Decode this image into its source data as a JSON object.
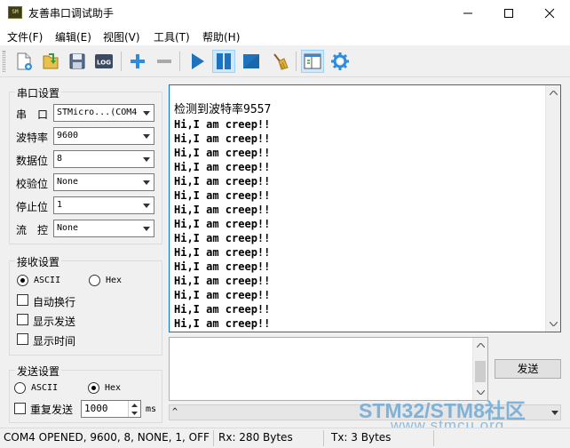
{
  "window": {
    "title": "友善串口调试助手",
    "icon_text": "SM"
  },
  "menu": [
    {
      "label": "文件(F)"
    },
    {
      "label": "编辑(E)"
    },
    {
      "label": "视图(V)"
    },
    {
      "label": "工具(T)"
    },
    {
      "label": "帮助(H)"
    }
  ],
  "toolbar": {
    "log_label": "LOG",
    "icons": [
      "new-file-icon",
      "open-file-icon",
      "save-icon",
      "log-icon",
      "add-icon",
      "remove-icon",
      "play-icon",
      "pause-icon",
      "stop-icon",
      "clear-broom-icon",
      "layout-icon",
      "settings-gear-icon"
    ]
  },
  "serial": {
    "group_title": "串口设置",
    "port_label": "串　口",
    "port_value": "STMicro...(COM4",
    "baud_label": "波特率",
    "baud_value": "9600",
    "databits_label": "数据位",
    "databits_value": "8",
    "parity_label": "校验位",
    "parity_value": "None",
    "stopbits_label": "停止位",
    "stopbits_value": "1",
    "flow_label": "流　控",
    "flow_value": "None"
  },
  "receive": {
    "group_title": "接收设置",
    "ascii_label": "ASCII",
    "hex_label": "Hex",
    "auto_wrap_label": "自动换行",
    "show_send_label": "显示发送",
    "show_time_label": "显示时间",
    "mode": "ascii",
    "lines": [
      "检测到波特率9557",
      "Hi,I am creep!!",
      "Hi,I am creep!!",
      "Hi,I am creep!!",
      "Hi,I am creep!!",
      "Hi,I am creep!!",
      "Hi,I am creep!!",
      "Hi,I am creep!!",
      "Hi,I am creep!!",
      "Hi,I am creep!!",
      "Hi,I am creep!!",
      "Hi,I am creep!!",
      "Hi,I am creep!!",
      "Hi,I am creep!!",
      "Hi,I am creep!!",
      "Hi,I am creep!!"
    ]
  },
  "send": {
    "group_title": "发送设置",
    "ascii_label": "ASCII",
    "hex_label": "Hex",
    "mode": "hex",
    "repeat_label": "重复发送",
    "repeat_interval": "1000",
    "interval_unit": "ms",
    "send_button": "发送",
    "text": ""
  },
  "status": {
    "connection": "COM4 OPENED, 9600, 8, NONE, 1, OFF",
    "rx": "Rx: 280 Bytes",
    "tx": "Tx: 3 Bytes"
  },
  "watermark": {
    "line1": "STM32/STM8社区",
    "line2": "www.stmcu.org"
  },
  "colors": {
    "accent_blue": "#1e73be",
    "focus_border": "#0078d7"
  }
}
